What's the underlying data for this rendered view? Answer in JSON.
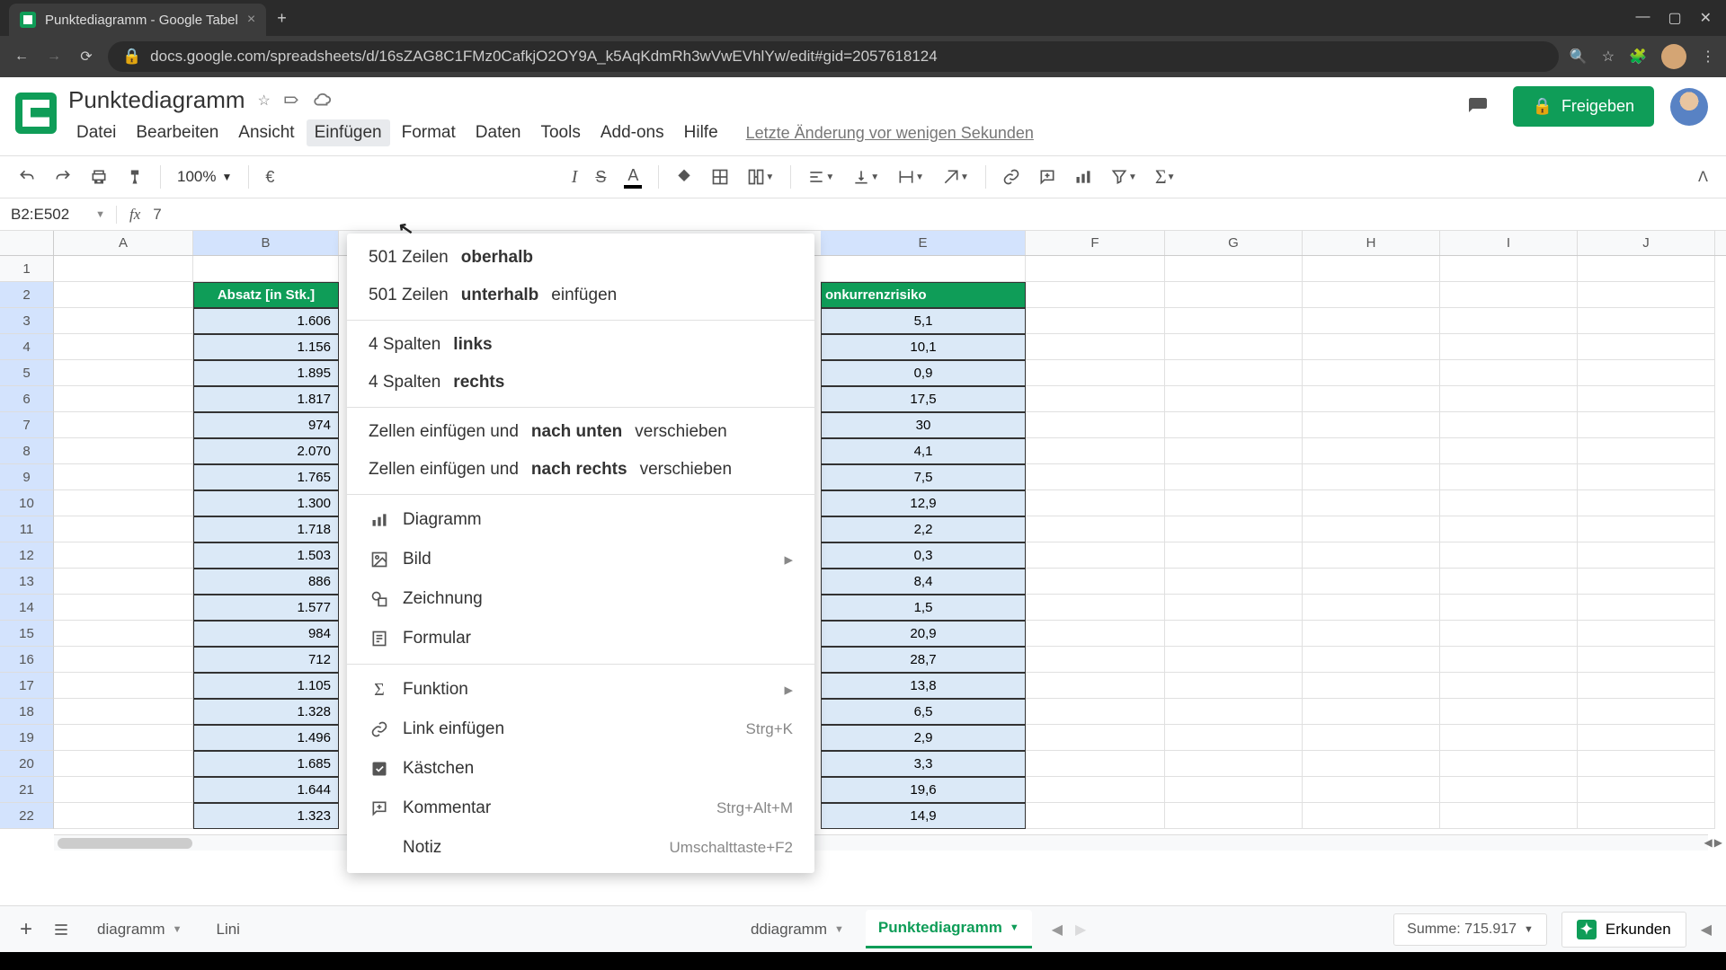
{
  "browser": {
    "tab_title": "Punktediagramm - Google Tabel",
    "url": "docs.google.com/spreadsheets/d/16sZAG8C1FMz0CafkjO2OY9A_k5AqKdmRh3wVwEVhlYw/edit#gid=2057618124"
  },
  "doc": {
    "title": "Punktediagramm",
    "last_edit": "Letzte Änderung vor wenigen Sekunden"
  },
  "menu": {
    "file": "Datei",
    "edit": "Bearbeiten",
    "view": "Ansicht",
    "insert": "Einfügen",
    "format": "Format",
    "data": "Daten",
    "tools": "Tools",
    "addons": "Add-ons",
    "help": "Hilfe"
  },
  "share": {
    "label": "Freigeben"
  },
  "toolbar": {
    "zoom": "100%",
    "currency": "€"
  },
  "ref": {
    "name": "B2:E502",
    "value": "7"
  },
  "columns": [
    "A",
    "B",
    "E",
    "F",
    "G",
    "H",
    "I",
    "J"
  ],
  "col_widths": {
    "A": 155,
    "B": 162,
    "E": 228,
    "F": 155,
    "G": 153,
    "H": 153,
    "I": 153,
    "J": 153
  },
  "dropdown": {
    "rows_above_a": "501 Zeilen ",
    "rows_above_b": "oberhalb",
    "rows_below_a": "501 Zeilen ",
    "rows_below_b": "unterhalb",
    "rows_below_c": " einfügen",
    "cols_left_a": "4 Spalten ",
    "cols_left_b": "links",
    "cols_right_a": "4 Spalten ",
    "cols_right_b": "rechts",
    "cells_down_a": "Zellen einfügen und ",
    "cells_down_b": "nach unten",
    "cells_down_c": " verschieben",
    "cells_right_a": "Zellen einfügen und ",
    "cells_right_b": "nach rechts",
    "cells_right_c": " verschieben",
    "chart": "Diagramm",
    "image": "Bild",
    "drawing": "Zeichnung",
    "form": "Formular",
    "function": "Funktion",
    "link": "Link einfügen",
    "link_sc": "Strg+K",
    "checkbox": "Kästchen",
    "comment": "Kommentar",
    "comment_sc": "Strg+Alt+M",
    "note": "Notiz",
    "note_sc": "Umschalttaste+F2"
  },
  "headers": {
    "b": "Absatz [in Stk.]",
    "e": "onkurrenzrisiko"
  },
  "rows": [
    {
      "n": 1,
      "b": "",
      "e": ""
    },
    {
      "n": 2,
      "b": "Absatz [in Stk.]",
      "e": "onkurrenzrisiko",
      "hdr": true
    },
    {
      "n": 3,
      "b": "1.606",
      "e": "5,1"
    },
    {
      "n": 4,
      "b": "1.156",
      "e": "10,1"
    },
    {
      "n": 5,
      "b": "1.895",
      "e": "0,9"
    },
    {
      "n": 6,
      "b": "1.817",
      "e": "17,5"
    },
    {
      "n": 7,
      "b": "974",
      "e": "30"
    },
    {
      "n": 8,
      "b": "2.070",
      "e": "4,1"
    },
    {
      "n": 9,
      "b": "1.765",
      "e": "7,5"
    },
    {
      "n": 10,
      "b": "1.300",
      "e": "12,9"
    },
    {
      "n": 11,
      "b": "1.718",
      "e": "2,2"
    },
    {
      "n": 12,
      "b": "1.503",
      "e": "0,3"
    },
    {
      "n": 13,
      "b": "886",
      "e": "8,4"
    },
    {
      "n": 14,
      "b": "1.577",
      "e": "1,5"
    },
    {
      "n": 15,
      "b": "984",
      "e": "20,9"
    },
    {
      "n": 16,
      "b": "712",
      "e": "28,7"
    },
    {
      "n": 17,
      "b": "1.105",
      "e": "13,8"
    },
    {
      "n": 18,
      "b": "1.328",
      "e": "6,5"
    },
    {
      "n": 19,
      "b": "1.496",
      "e": "2,9"
    },
    {
      "n": 20,
      "b": "1.685",
      "e": "3,3"
    },
    {
      "n": 21,
      "b": "1.644",
      "e": "19,6"
    },
    {
      "n": 22,
      "b": "1.323",
      "e": "14,9"
    }
  ],
  "tabs": {
    "t1": "diagramm",
    "t2": "Lini",
    "t3": "ddiagramm",
    "t4": "Punktediagramm"
  },
  "footer": {
    "sum": "Summe: 715.917",
    "explore": "Erkunden"
  }
}
